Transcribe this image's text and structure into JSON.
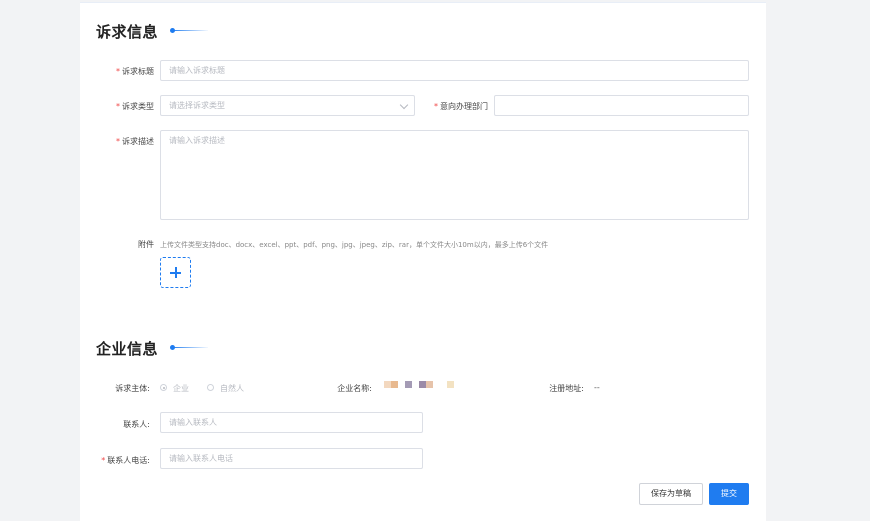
{
  "appeal_section": {
    "title": "诉求信息",
    "title_field": {
      "label": "诉求标题",
      "placeholder": "请输入诉求标题"
    },
    "type_field": {
      "label": "诉求类型",
      "placeholder": "请选择诉求类型"
    },
    "department_field": {
      "label": "意向办理部门",
      "value": ""
    },
    "description_field": {
      "label": "诉求描述",
      "placeholder": "请输入诉求描述"
    },
    "attachment": {
      "label": "附件",
      "hint": "上传文件类型支持doc、docx、excel、ppt、pdf、png、jpg、jpeg、zip、rar，单个文件大小10m以内，最多上传6个文件"
    }
  },
  "company_section": {
    "title": "企业信息",
    "subject_label": "诉求主体:",
    "subject_options": [
      {
        "label": "企业",
        "checked": true
      },
      {
        "label": "自然人",
        "checked": false
      }
    ],
    "company_name_label": "企业名称:",
    "address_label": "注册地址:",
    "address_value": "--",
    "contact_field": {
      "label": "联系人:",
      "placeholder": "请输入联系人"
    },
    "phone_field": {
      "label": "联系人电话:",
      "placeholder": "请输入联系人电话"
    }
  },
  "actions": {
    "save_draft": "保存为草稿",
    "submit": "提交"
  },
  "colors": {
    "accent": "#1f7cf0",
    "required": "#f04848",
    "mosaic": [
      "#f3d8bf",
      "#e8b98f",
      "#ffffff",
      "#a49bb5",
      "#ffffff",
      "#9b8aa7",
      "#e6c3aa",
      "#ffffff",
      "#f3e2c2"
    ]
  }
}
